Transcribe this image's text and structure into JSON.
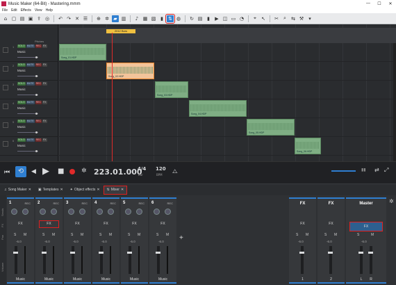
{
  "titlebar": {
    "title": "Music Maker (64-Bit) - Mastering.mmm",
    "min": "—",
    "max": "☐",
    "close": "✕"
  },
  "menu": [
    "File",
    "Edit",
    "Effects",
    "View",
    "Help"
  ],
  "ruler": {
    "pitches_label": "Pitches",
    "range_label": "2012 Bars"
  },
  "tracks": [
    {
      "num": "1",
      "name": "Music",
      "clip": "Song_01.HDP"
    },
    {
      "num": "2",
      "name": "Music",
      "clip": "Song_02.HDP"
    },
    {
      "num": "3",
      "name": "Music",
      "clip": "Song_03.HDP"
    },
    {
      "num": "4",
      "name": "Music",
      "clip": "Song_04.HDP"
    },
    {
      "num": "5",
      "name": "Music",
      "clip": "Song_05.HDP"
    },
    {
      "num": "6",
      "name": "Music",
      "clip": "Song_06.HDP"
    }
  ],
  "track_buttons": {
    "solo": "SOLO",
    "mute": "MUTE",
    "rec": "REC",
    "fx": "FX"
  },
  "transport": {
    "position": "223.01.000",
    "signature": "4/4",
    "signature_unit": "Bar",
    "bpm": "120",
    "bpm_unit": "BPM"
  },
  "tabs": [
    {
      "label": "Song Maker"
    },
    {
      "label": "Templates"
    },
    {
      "label": "Object effects"
    },
    {
      "label": "Mixer"
    }
  ],
  "mixer": {
    "side_labels": {
      "sends": "Sends",
      "fx": "FX",
      "pan": "Pan",
      "volume": "Volume"
    },
    "channels": [
      {
        "num": "1",
        "name": "Music",
        "db": "-6.0"
      },
      {
        "num": "2",
        "name": "Music",
        "db": "-6.0"
      },
      {
        "num": "3",
        "name": "Music",
        "db": "-6.0"
      },
      {
        "num": "4",
        "name": "Music",
        "db": "-6.0"
      },
      {
        "num": "5",
        "name": "Music",
        "db": "-6.0"
      },
      {
        "num": "6",
        "name": "Music",
        "db": "-6.0"
      }
    ],
    "rec_label": "REC",
    "fx_label": "FX",
    "s_label": "S",
    "m_label": "M",
    "add_label": "+",
    "fx_busses": [
      {
        "title": "FX",
        "num": "1",
        "db": "-6.0"
      },
      {
        "title": "FX",
        "num": "2",
        "db": "-6.0"
      }
    ],
    "master": {
      "title": "Master",
      "fx": "FX",
      "db": "-6.0",
      "l": "L",
      "r": "R"
    }
  },
  "colors": {
    "accent": "#2f7fd1",
    "highlight": "#e02020",
    "clip": "#7fae84",
    "clip_selected": "#f3c49a",
    "playhead": "#e02a2a"
  }
}
